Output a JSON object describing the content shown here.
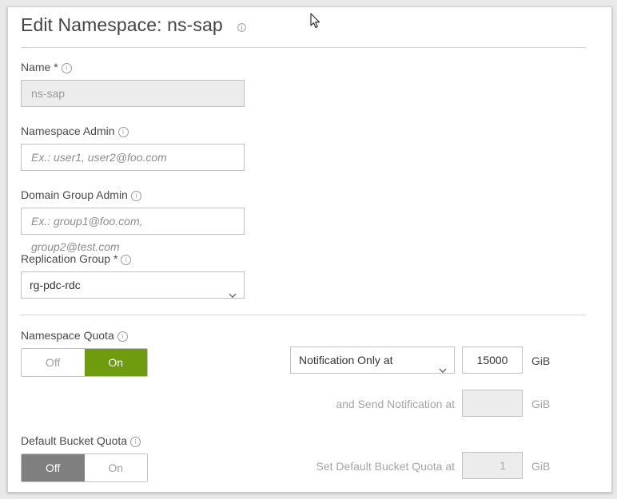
{
  "header": {
    "title": "Edit Namespace:  ns-sap"
  },
  "form": {
    "name": {
      "label": "Name *",
      "value": "ns-sap"
    },
    "namespace_admin": {
      "label": "Namespace Admin",
      "placeholder": "Ex.: user1, user2@foo.com"
    },
    "domain_group_admin": {
      "label": "Domain Group Admin",
      "placeholder": "Ex.: group1@foo.com, group2@test.com"
    },
    "replication_group": {
      "label": "Replication Group *",
      "selected": "rg-pdc-rdc"
    },
    "namespace_quota": {
      "label": "Namespace Quota",
      "toggle_off": "Off",
      "toggle_on": "On",
      "state": "on",
      "notification_mode": "Notification Only at",
      "notification_value": "15000",
      "unit": "GiB",
      "send_notification_label": "and Send Notification at",
      "send_notification_value": "",
      "send_notification_unit": "GiB"
    },
    "default_bucket_quota": {
      "label": "Default Bucket Quota",
      "toggle_off": "Off",
      "toggle_on": "On",
      "state": "off",
      "set_label": "Set Default Bucket Quota at",
      "set_value": "1",
      "unit": "GiB"
    }
  },
  "icons": {
    "info": "info-circle-icon",
    "chevron": "chevron-down-icon",
    "cursor": "mouse-pointer-icon"
  },
  "colors": {
    "toggle_on": "#6f9b0f",
    "toggle_off_selected": "#7f7f7f"
  }
}
